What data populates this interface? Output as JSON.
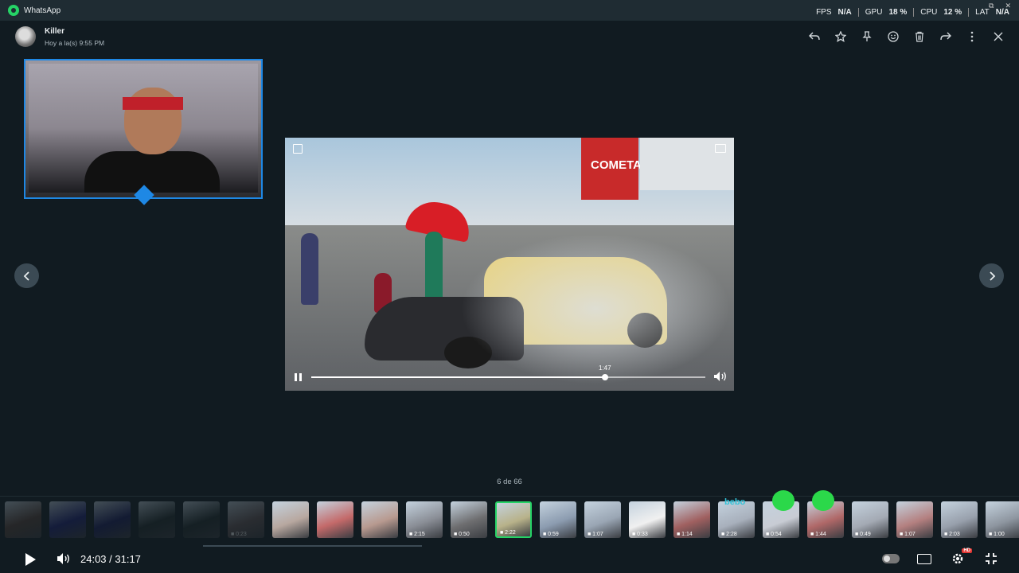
{
  "app": {
    "title": "WhatsApp"
  },
  "perf": {
    "fps_label": "FPS",
    "fps": "N/A",
    "gpu_label": "GPU",
    "gpu": "18 %",
    "cpu_label": "CPU",
    "cpu": "12 %",
    "lat_label": "LAT",
    "lat": "N/A"
  },
  "header": {
    "contact_name": "Killer",
    "timestamp": "Hoy a la(s) 9:55 PM"
  },
  "toolbar": {
    "icons": [
      "reply-icon",
      "star-icon",
      "pin-icon",
      "emoji-icon",
      "delete-icon",
      "forward-icon",
      "more-icon",
      "close-icon"
    ]
  },
  "video": {
    "billboard_text": "COMETA",
    "progress": 0.745,
    "tooltip": "1:47"
  },
  "media": {
    "counter": "6 de 66"
  },
  "thumbnails": [
    {
      "dur": "",
      "color": "#5a4238",
      "dim": true
    },
    {
      "dur": "",
      "color": "#1b1f7a",
      "dim": true
    },
    {
      "dur": "",
      "color": "#171a5e",
      "dim": true
    },
    {
      "dur": "",
      "color": "#1f2a2a",
      "dim": true
    },
    {
      "dur": "",
      "color": "#1f2a2a",
      "dim": true
    },
    {
      "dur": "0:23",
      "color": "#6a5a5a",
      "dim": true
    },
    {
      "dur": "",
      "color": "#b8a8a0",
      "dim": false
    },
    {
      "dur": "",
      "color": "#c46a6a",
      "dim": false
    },
    {
      "dur": "",
      "color": "#b89a90",
      "dim": false
    },
    {
      "dur": "2:15",
      "color": "#8a8e96",
      "dim": false
    },
    {
      "dur": "0:50",
      "color": "#6e6e70",
      "dim": false
    },
    {
      "dur": "2:22",
      "color": "#b8b28a",
      "dim": false,
      "selected": true
    },
    {
      "dur": "0:59",
      "color": "#8c9cb0",
      "dim": false
    },
    {
      "dur": "1:07",
      "color": "#9aa6b4",
      "dim": false
    },
    {
      "dur": "0:33",
      "color": "#f0f0f0",
      "dim": false
    },
    {
      "dur": "1:14",
      "color": "#a06060",
      "dim": false
    },
    {
      "dur": "2:28",
      "color": "#a8b0bc",
      "dim": false
    },
    {
      "dur": "0:54",
      "color": "#c8ccd4",
      "dim": false
    },
    {
      "dur": "1:44",
      "color": "#b06868",
      "dim": false
    },
    {
      "dur": "0:49",
      "color": "#a4aab4",
      "dim": false
    },
    {
      "dur": "1:07",
      "color": "#b48080",
      "dim": false
    },
    {
      "dur": "2:03",
      "color": "#98a0ac",
      "dim": false
    },
    {
      "dur": "1:00",
      "color": "#8e96a0",
      "dim": false
    }
  ],
  "sticker_text": "bebo",
  "player": {
    "time": "24:03 / 31:17",
    "hd_badge": "HD"
  }
}
